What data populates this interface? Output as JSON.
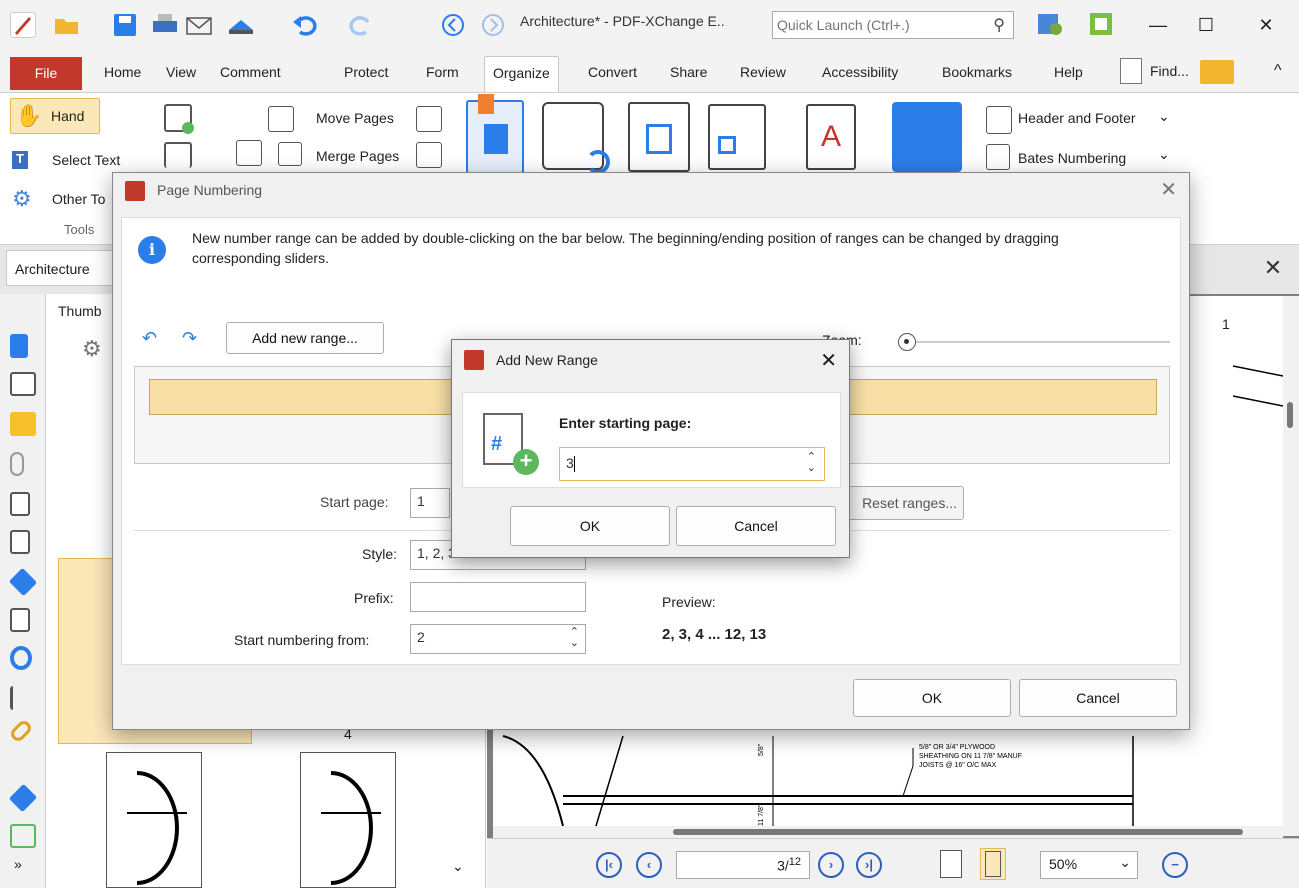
{
  "window": {
    "title": "Architecture* - PDF-XChange E..",
    "quick_launch_placeholder": "Quick Launch (Ctrl+.)"
  },
  "tabs": {
    "file": "File",
    "items": [
      "Home",
      "View",
      "Comment",
      "Protect",
      "Form",
      "Organize",
      "Convert",
      "Share",
      "Review",
      "Accessibility",
      "Bookmarks",
      "Help"
    ],
    "active": "Organize",
    "find": "Find..."
  },
  "ribbon": {
    "tools": {
      "hand": "Hand",
      "select_text": "Select Text",
      "other_tools": "Other To",
      "group_label": "Tools"
    },
    "move_pages": "Move Pages",
    "merge_pages": "Merge Pages",
    "header_footer": "Header and Footer",
    "bates": "Bates Numbering"
  },
  "document": {
    "tab": "Architecture",
    "thumbnails_title": "Thumb",
    "page_number_label": "1",
    "thumb_labels": [
      "4"
    ]
  },
  "page_numbering": {
    "title": "Page Numbering",
    "info": "New number range can be added by double-clicking on the bar below. The beginning/ending position of ranges can be changed by dragging corresponding sliders.",
    "add_range": "Add new range...",
    "zoom_label": "Zoom:",
    "start_page_label": "Start page:",
    "start_page_value": "1",
    "reset_ranges": "Reset ranges...",
    "style_label": "Style:",
    "style_value": "1, 2, 3",
    "prefix_label": "Prefix:",
    "prefix_value": "",
    "start_from_label": "Start numbering from:",
    "start_from_value": "2",
    "preview_label": "Preview:",
    "preview_value": "2, 3, 4 ... 12, 13",
    "ok": "OK",
    "cancel": "Cancel"
  },
  "add_new_range": {
    "title": "Add New Range",
    "prompt": "Enter starting page:",
    "value": "3",
    "ok": "OK",
    "cancel": "Cancel"
  },
  "drawing_notes": {
    "line1": "5/8\" OR 3/4\" PLYWOOD",
    "line2": "SHEATHING ON 11 7/8\" MANUF",
    "line3": "JOISTS @ 16\" O/C MAX",
    "dim1": "5/8\"",
    "dim2": "11 7/8\""
  },
  "statusbar": {
    "page_current": "3",
    "page_total": "12",
    "zoom": "50%"
  },
  "colors": {
    "accent": "#c0392b",
    "brand_blue": "#2b7de9",
    "range_bar": "#f7dfa6"
  }
}
